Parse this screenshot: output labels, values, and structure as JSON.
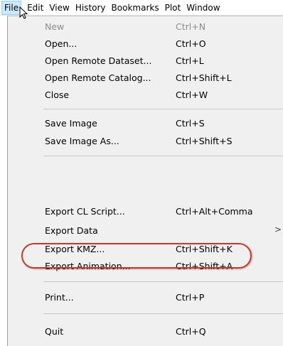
{
  "menubar": {
    "items": [
      "File",
      "Edit",
      "View",
      "History",
      "Bookmarks",
      "Plot",
      "Window"
    ]
  },
  "menu": {
    "items": [
      {
        "label": "New",
        "shortcut": "Ctrl+N",
        "enabled": false
      },
      {
        "label": "Open...",
        "shortcut": "Ctrl+O",
        "enabled": true
      },
      {
        "label": "Open Remote Dataset...",
        "shortcut": "Ctrl+L",
        "enabled": true
      },
      {
        "label": "Open Remote Catalog...",
        "shortcut": "Ctrl+Shift+L",
        "enabled": true
      },
      {
        "label": "Close",
        "shortcut": "Ctrl+W",
        "enabled": true
      },
      {
        "label": "Save Image",
        "shortcut": "Ctrl+S",
        "enabled": true
      },
      {
        "label": "Save Image As...",
        "shortcut": "Ctrl+Shift+S",
        "enabled": true
      },
      {
        "label": "Export CL Script...",
        "shortcut": "Ctrl+Alt+Comma",
        "enabled": true
      },
      {
        "label": "Export Data",
        "shortcut": "",
        "enabled": true,
        "submenu_arrow": ">"
      },
      {
        "label": "Export KMZ...",
        "shortcut": "Ctrl+Shift+K",
        "enabled": true,
        "highlighted": true
      },
      {
        "label": "Export Animation...",
        "shortcut": "Ctrl+Shift+A",
        "enabled": true
      },
      {
        "label": "Print...",
        "shortcut": "Ctrl+P",
        "enabled": true
      },
      {
        "label": "Quit",
        "shortcut": "Ctrl+Q",
        "enabled": true
      }
    ]
  },
  "colors": {
    "menu_background": "#f0f0f0",
    "active_menubar": "#cce8ff",
    "highlight_oval": "#c0392b",
    "disabled_text": "#8c8c8c"
  }
}
